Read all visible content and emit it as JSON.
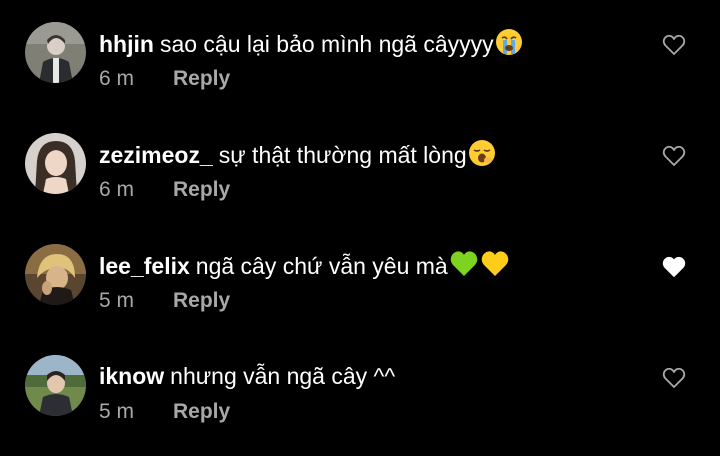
{
  "comments": [
    {
      "username": "hhjin",
      "text": "sao cậu lại bảo mình ngã câyyyy",
      "emoji": "crying-face",
      "time": "6 m",
      "reply_label": "Reply",
      "liked": false
    },
    {
      "username": "zezimeoz_",
      "text": "sự thật thường mất lòng",
      "emoji": "yawning-face",
      "time": "6 m",
      "reply_label": "Reply",
      "liked": false
    },
    {
      "username": "lee_felix",
      "text": "ngã cây chứ vẫn yêu mà",
      "emoji": "green-heart yellow-heart",
      "time": "5 m",
      "reply_label": "Reply",
      "liked": true
    },
    {
      "username": "iknow",
      "text": "nhưng vẫn ngã cây ^^",
      "emoji": "",
      "time": "5 m",
      "reply_label": "Reply",
      "liked": false
    }
  ],
  "colors": {
    "background": "#000000",
    "username": "#ffffff",
    "secondary": "#a8a8a8",
    "heart_outline": "#a8a8a8",
    "heart_filled": "#ffffff"
  }
}
